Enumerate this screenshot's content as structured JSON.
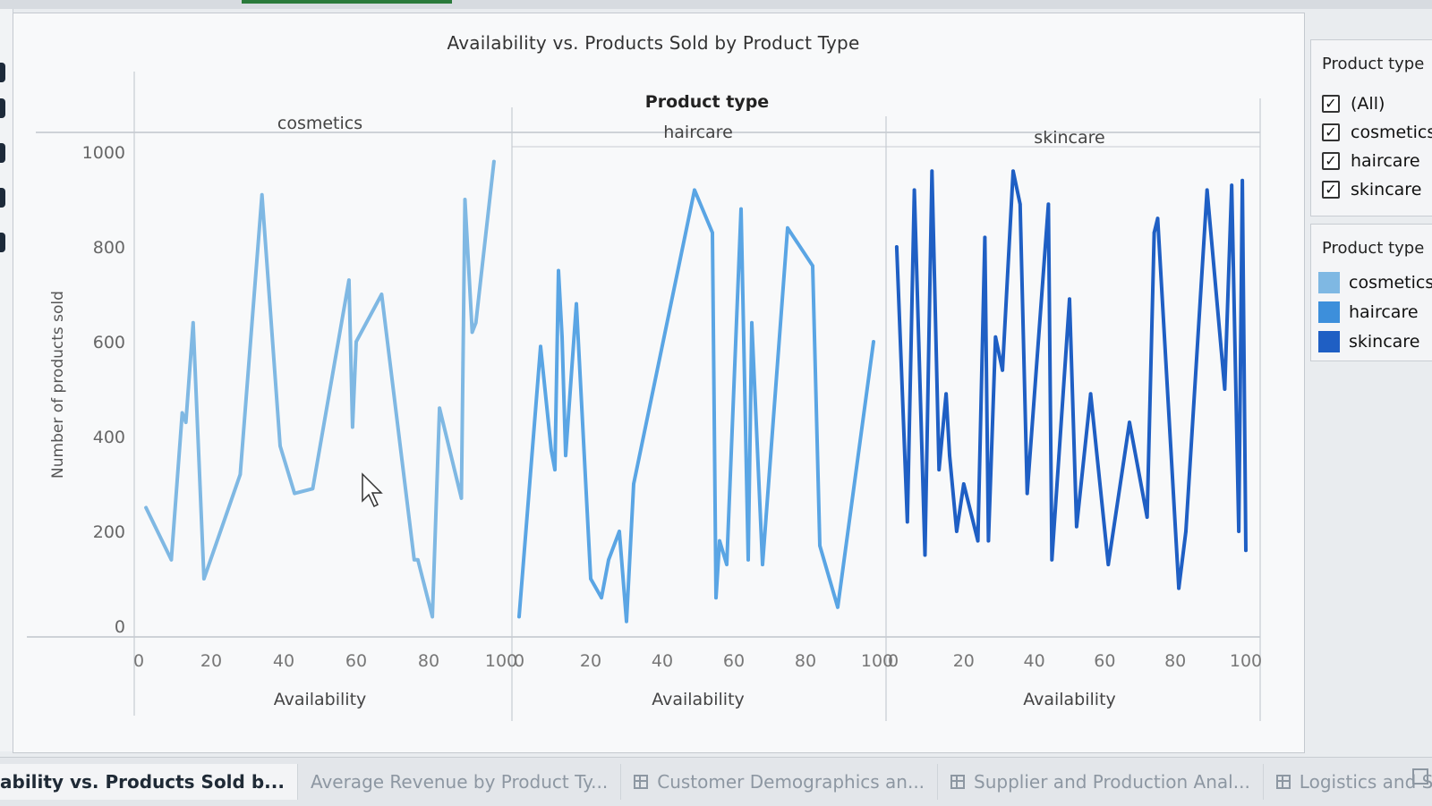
{
  "tabs": [
    {
      "label": "ability vs. Products Sold b...",
      "active": true,
      "icon": ""
    },
    {
      "label": "Average Revenue by Product Ty...",
      "active": false,
      "icon": ""
    },
    {
      "label": "Customer Demographics an...",
      "active": false,
      "icon": "grid-icon"
    },
    {
      "label": "Supplier and Production Anal...",
      "active": false,
      "icon": "grid-icon"
    },
    {
      "label": "Logistics and Shippin",
      "active": false,
      "icon": "grid-icon"
    }
  ],
  "filter": {
    "title": "Product type",
    "items": [
      {
        "label": "(All)",
        "checked": true
      },
      {
        "label": "cosmetics",
        "checked": true
      },
      {
        "label": "haircare",
        "checked": true
      },
      {
        "label": "skincare",
        "checked": true
      }
    ]
  },
  "legend": {
    "title": "Product type",
    "items": [
      {
        "label": "cosmetics",
        "color": "#7fb8e3"
      },
      {
        "label": "haircare",
        "color": "#3d8fdb"
      },
      {
        "label": "skincare",
        "color": "#1f5fc4"
      }
    ]
  },
  "chart_data": {
    "type": "line",
    "title": "Availability vs. Products Sold by Product Type",
    "facet_header": "Product type",
    "xlabel": "Availability",
    "ylabel": "Number of products sold",
    "xlim": [
      0,
      100
    ],
    "ylim": [
      0,
      1000
    ],
    "xticks": [
      "0",
      "20",
      "40",
      "60",
      "80",
      "100"
    ],
    "yticks": [
      "0",
      "200",
      "400",
      "600",
      "800",
      "1000"
    ],
    "grid": false,
    "panels": [
      {
        "name": "cosmetics",
        "color": "#7fb8e3",
        "x": [
          2,
          9,
          12,
          13,
          15,
          18,
          28,
          34,
          39,
          43,
          48,
          58,
          59,
          60,
          67,
          76,
          77,
          81,
          83,
          89,
          90,
          92,
          93,
          98
        ],
        "y": [
          250,
          140,
          450,
          430,
          640,
          100,
          320,
          910,
          380,
          280,
          290,
          730,
          420,
          600,
          700,
          140,
          140,
          20,
          460,
          270,
          900,
          620,
          640,
          980
        ]
      },
      {
        "name": "haircare",
        "color": "#5aa5e4",
        "x": [
          0,
          6,
          9,
          10,
          11,
          12,
          13,
          16,
          20,
          23,
          25,
          28,
          30,
          32,
          49,
          54,
          55,
          56,
          58,
          62,
          64,
          65,
          68,
          75,
          82,
          84,
          89,
          99
        ],
        "y": [
          20,
          590,
          370,
          330,
          750,
          610,
          360,
          680,
          100,
          60,
          140,
          200,
          10,
          300,
          920,
          830,
          60,
          180,
          130,
          880,
          140,
          640,
          130,
          840,
          760,
          170,
          40,
          600
        ]
      },
      {
        "name": "skincare",
        "color": "#1f5fc4",
        "x": [
          1,
          4,
          6,
          9,
          11,
          13,
          15,
          16,
          18,
          20,
          24,
          26,
          27,
          29,
          31,
          34,
          36,
          38,
          44,
          45,
          47,
          50,
          52,
          56,
          61,
          67,
          72,
          74,
          75,
          81,
          83,
          89,
          94,
          96,
          98,
          99,
          100
        ],
        "y": [
          800,
          220,
          920,
          150,
          960,
          330,
          490,
          360,
          200,
          300,
          180,
          820,
          180,
          610,
          540,
          960,
          890,
          280,
          890,
          140,
          360,
          690,
          210,
          490,
          130,
          430,
          230,
          830,
          860,
          80,
          200,
          920,
          500,
          930,
          200,
          940,
          160
        ]
      }
    ]
  }
}
